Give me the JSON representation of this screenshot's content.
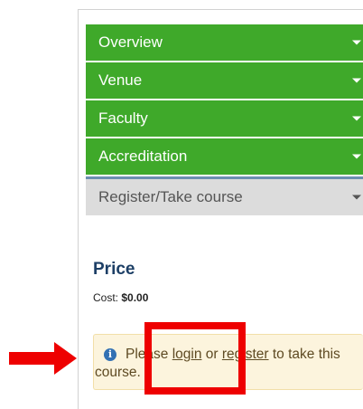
{
  "accordion": {
    "items": [
      {
        "label": "Overview"
      },
      {
        "label": "Venue"
      },
      {
        "label": "Faculty"
      },
      {
        "label": "Accreditation"
      },
      {
        "label": "Register/Take course"
      }
    ]
  },
  "price": {
    "title": "Price",
    "cost_label": "Cost:",
    "cost_value": "$0.00"
  },
  "alert": {
    "text_before": "Please ",
    "login_link": "login",
    "text_middle": " or ",
    "register_link": "register",
    "text_after": " to take this",
    "line2": "course."
  },
  "colors": {
    "accordion_green": "#3fa92a",
    "active_tab_grey": "#dcdcdc",
    "price_title": "#1d3f66",
    "alert_bg": "#fcf4dd",
    "annotation_red": "#ee0000"
  },
  "icons": {
    "info": "info-circle",
    "annotation_arrow": "right-arrow"
  }
}
